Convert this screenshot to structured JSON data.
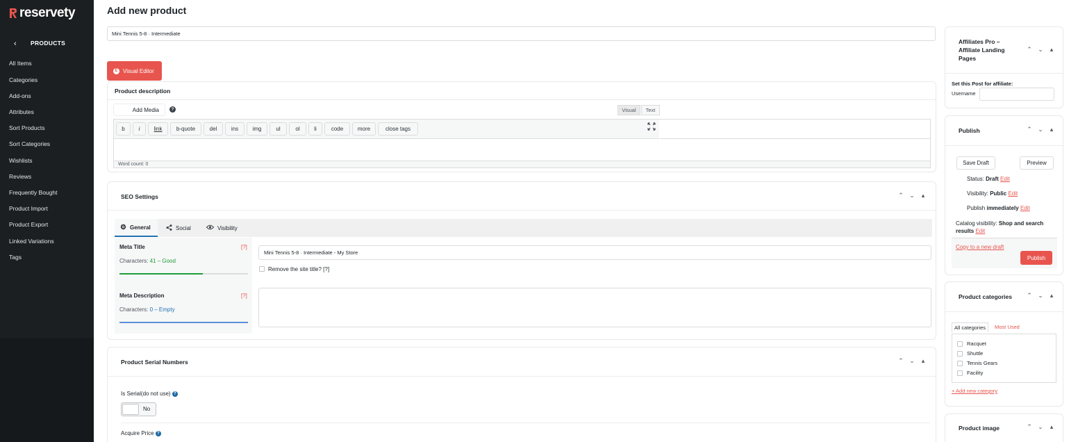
{
  "sidebar": {
    "logo_text": "reservety",
    "back_icon": "chevron-left-icon",
    "section_title": "PRODUCTS",
    "items": [
      {
        "label": "All Items"
      },
      {
        "label": "Categories"
      },
      {
        "label": "Add-ons"
      },
      {
        "label": "Attributes"
      },
      {
        "label": "Sort Products"
      },
      {
        "label": "Sort Categories"
      },
      {
        "label": "Wishlists"
      },
      {
        "label": "Reviews"
      },
      {
        "label": "Frequently Bought"
      },
      {
        "label": "Product Import"
      },
      {
        "label": "Product Export"
      },
      {
        "label": "Linked Variations"
      },
      {
        "label": "Tags"
      }
    ]
  },
  "page": {
    "title": "Add new product",
    "product_title": "Mini Tennis 5-8 · Intermediate",
    "visual_editor_label": "Visual Editor",
    "visual_editor_icon": "elementor-icon"
  },
  "description": {
    "heading": "Product description",
    "add_media": "Add Media",
    "help_icon": "question-icon",
    "tab_visual": "Visual",
    "tab_text": "Text",
    "toolbar": [
      "b",
      "i",
      "link",
      "b-quote",
      "del",
      "ins",
      "img",
      "ul",
      "ol",
      "li",
      "code",
      "more",
      "close tags"
    ],
    "fullscreen_icon": "fullscreen-icon",
    "word_count": "Word count: 0"
  },
  "seo": {
    "heading": "SEO Settings",
    "tabs": [
      {
        "label": "General",
        "icon": "gear-icon"
      },
      {
        "label": "Social",
        "icon": "share-icon"
      },
      {
        "label": "Visibility",
        "icon": "eye-icon"
      }
    ],
    "meta_title_label": "Meta Title",
    "meta_title_help": "[?]",
    "meta_title_chars_prefix": "Characters: ",
    "meta_title_chars_value": "41 – Good",
    "meta_title_value": "Mini Tennis 5-8 · Intermediate - My Store",
    "meta_title_progress": 0.65,
    "remove_site_title": "Remove the site title? [?]",
    "meta_desc_label": "Meta Description",
    "meta_desc_help": "[?]",
    "meta_desc_chars_prefix": "Characters: ",
    "meta_desc_chars_value": "0 – Empty",
    "meta_desc_progress": 1.0
  },
  "serial": {
    "heading": "Product Serial Numbers",
    "is_serial_label": "Is Serial(do not use)",
    "toggle_value": "No",
    "acquire_price_label": "Acquire Price"
  },
  "affiliates": {
    "heading": "Affiliates Pro – Affiliate Landing Pages",
    "set_post_label": "Set this Post for affiliate:",
    "username_label": "Username"
  },
  "publish": {
    "heading": "Publish",
    "save_draft": "Save Draft",
    "preview": "Preview",
    "status_label": "Status: ",
    "status_value": "Draft",
    "visibility_label": "Visibility: ",
    "visibility_value": "Public",
    "publish_label": "Publish ",
    "publish_value": "immediately",
    "edit_link": "Edit",
    "catalog_label": "Catalog visibility: ",
    "catalog_value": "Shop and search results",
    "copy_draft": "Copy to a new draft",
    "publish_button": "Publish"
  },
  "categories": {
    "heading": "Product categories",
    "tab_all": "All categories",
    "tab_most_used": "Most Used",
    "items": [
      "Racquet",
      "Shuttle",
      "Tennis Gears",
      "Facility"
    ],
    "add_new": "+ Add new category"
  },
  "image": {
    "heading": "Product image"
  },
  "colors": {
    "accent": "#e8554e",
    "sidebar_bg": "#1b1f22",
    "good": "#1f9d3a",
    "empty": "#2271b1"
  }
}
